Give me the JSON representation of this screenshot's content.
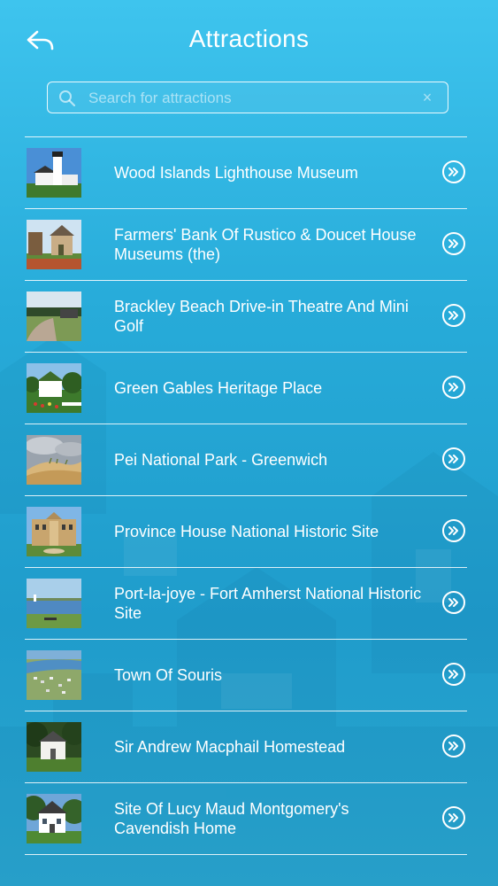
{
  "header": {
    "title": "Attractions",
    "back_icon": "back-arrow-icon"
  },
  "search": {
    "placeholder": "Search for attractions",
    "value": "",
    "search_icon": "search-icon",
    "clear_label": "×",
    "clear_icon": "clear-icon"
  },
  "attractions": [
    {
      "name": "Wood Islands Lighthouse Museum",
      "thumb": "lighthouse"
    },
    {
      "name": "Farmers' Bank Of Rustico & Doucet House Museums (the)",
      "thumb": "houses"
    },
    {
      "name": "Brackley Beach Drive-in Theatre And Mini Golf",
      "thumb": "drivein"
    },
    {
      "name": "Green Gables Heritage Place",
      "thumb": "greengables"
    },
    {
      "name": "Pei National Park - Greenwich",
      "thumb": "dunes"
    },
    {
      "name": "Province House National Historic Site",
      "thumb": "provincehouse"
    },
    {
      "name": "Port-la-joye - Fort Amherst National Historic Site",
      "thumb": "bay"
    },
    {
      "name": "Town Of Souris",
      "thumb": "aerial"
    },
    {
      "name": "Sir Andrew Macphail Homestead",
      "thumb": "homestead"
    },
    {
      "name": "Site Of Lucy Maud Montgomery's Cavendish Home",
      "thumb": "cavendish"
    }
  ],
  "row_action_icon": "chevron-double-right-icon",
  "colors": {
    "background_top": "#3ec4ee",
    "background_bottom": "#1f9ccb",
    "text": "#ffffff"
  }
}
